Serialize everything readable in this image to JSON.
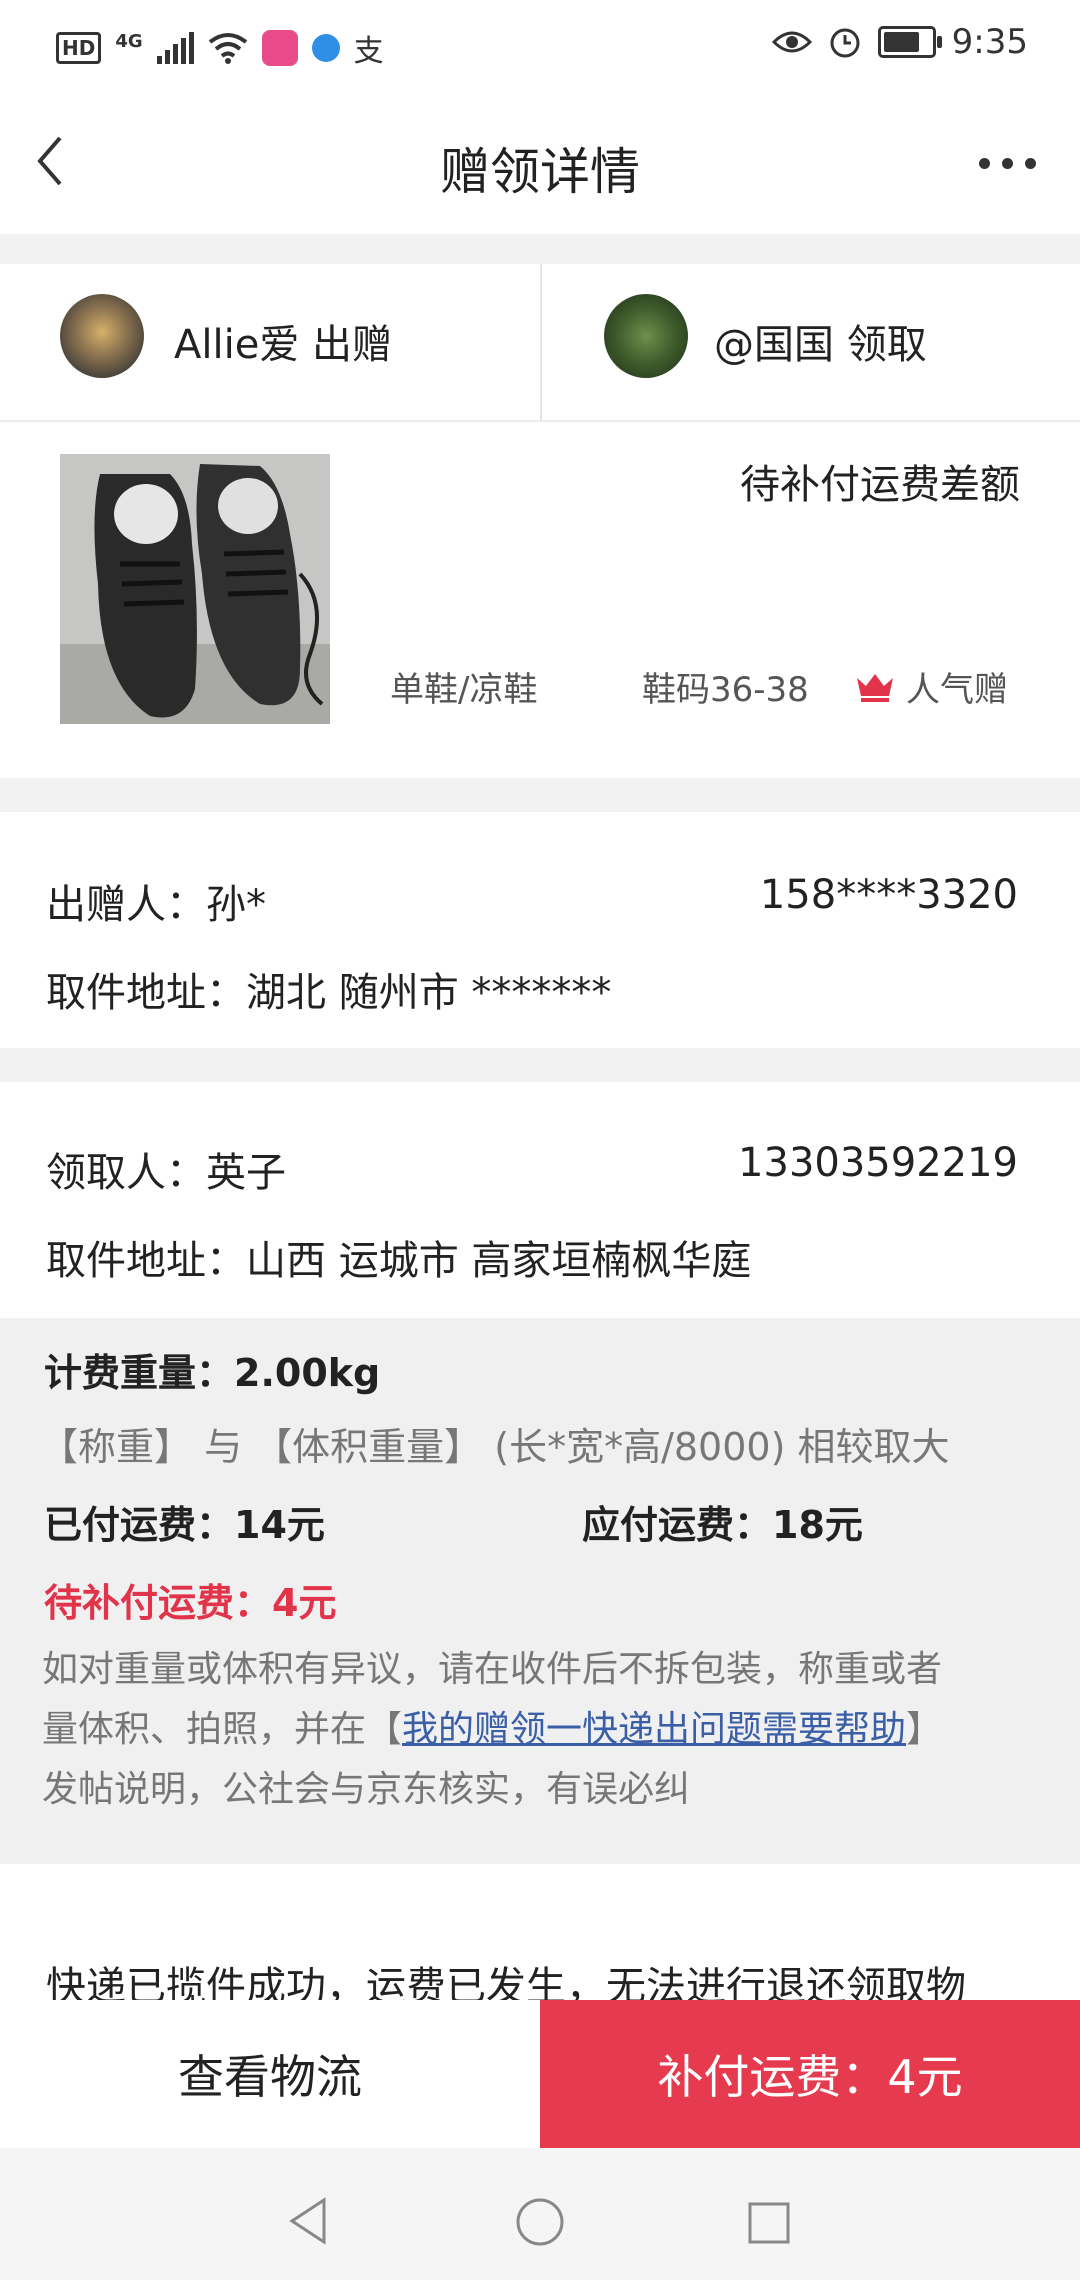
{
  "status_bar": {
    "hd": "HD",
    "network": "4G",
    "time": "9:35"
  },
  "nav": {
    "title": "赠领详情"
  },
  "users": {
    "giver": "Allie爱 出赠",
    "receiver": "@国国 领取"
  },
  "item": {
    "status": "待补付运费差额",
    "category": "单鞋/凉鞋",
    "size": "鞋码36-38",
    "tag": "人气赠"
  },
  "sender": {
    "label": "出赠人：孙*",
    "phone": "158****3320",
    "address": "取件地址：湖北 随州市 *******"
  },
  "recipient": {
    "label": "领取人：英子",
    "phone": "13303592219",
    "address": "取件地址：山西 运城市 高家垣楠枫华庭"
  },
  "fee": {
    "weight": "计费重量：2.00kg",
    "rule": "【称重】 与 【体积重量】 (长*宽*高/8000) 相较取大",
    "paid": "已付运费：14元",
    "due": "应付运费：18元",
    "pending": "待补付运费：4元",
    "note_line1": "如对重量或体积有异议，请在收件后不拆包装，称重或者",
    "note_line2_pre": "量体积、拍照，并在【",
    "note_link": "我的赠领一快递出问题需要帮助",
    "note_line2_post": "】",
    "note_line3": "发帖说明，公社会与京东核实，有误必纠"
  },
  "notice": "快递已揽件成功，运费已发生，无法进行退还领取物",
  "actions": {
    "logistics": "查看物流",
    "pay": "补付运费：4元"
  },
  "colors": {
    "accent_red": "#e63b4f",
    "link_blue": "#3a5fa7"
  },
  "icons": [
    "back-icon",
    "more-icon",
    "crown-icon",
    "nav-back-icon",
    "nav-home-icon",
    "nav-recent-icon"
  ]
}
